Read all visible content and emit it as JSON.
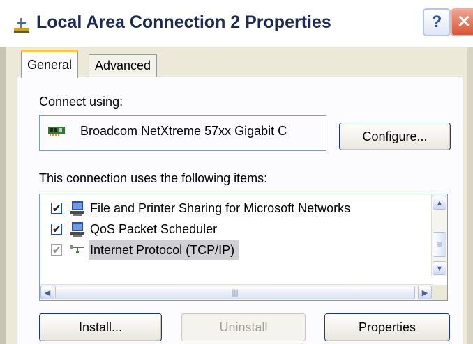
{
  "window": {
    "title": "Local Area Connection 2 Properties",
    "help_glyph": "?",
    "close_glyph": "✕",
    "icon": "network-connection-icon"
  },
  "tabs": [
    {
      "label": "General",
      "selected": true
    },
    {
      "label": "Advanced",
      "selected": false
    }
  ],
  "general": {
    "connect_using_label": "Connect using:",
    "adapter": {
      "name": "Broadcom NetXtreme 57xx Gigabit C",
      "icon": "network-adapter-icon"
    },
    "configure_label": "Configure...",
    "items_label": "This connection uses the following items:",
    "items": [
      {
        "label": "File and Printer Sharing for Microsoft Networks",
        "checked": true,
        "icon": "file-printer-sharing-icon",
        "selected": false
      },
      {
        "label": "QoS Packet Scheduler",
        "checked": true,
        "icon": "qos-scheduler-icon",
        "selected": false
      },
      {
        "label": "Internet Protocol (TCP/IP)",
        "checked": true,
        "icon": "network-protocol-icon",
        "selected": true
      }
    ],
    "checkmark_glyph": "✔",
    "scroll": {
      "up": "▲",
      "down": "▼",
      "left": "◀",
      "right": "▶",
      "vgrip": "≡",
      "hgrip": "|||"
    },
    "install_label": "Install...",
    "uninstall_label": "Uninstall",
    "properties_label": "Properties"
  },
  "colors": {
    "title_text": "#1c2a55",
    "dialog_bg": "#ece9d8",
    "tab_accent": "#ffc83c",
    "selection": "#cfcfd4"
  }
}
